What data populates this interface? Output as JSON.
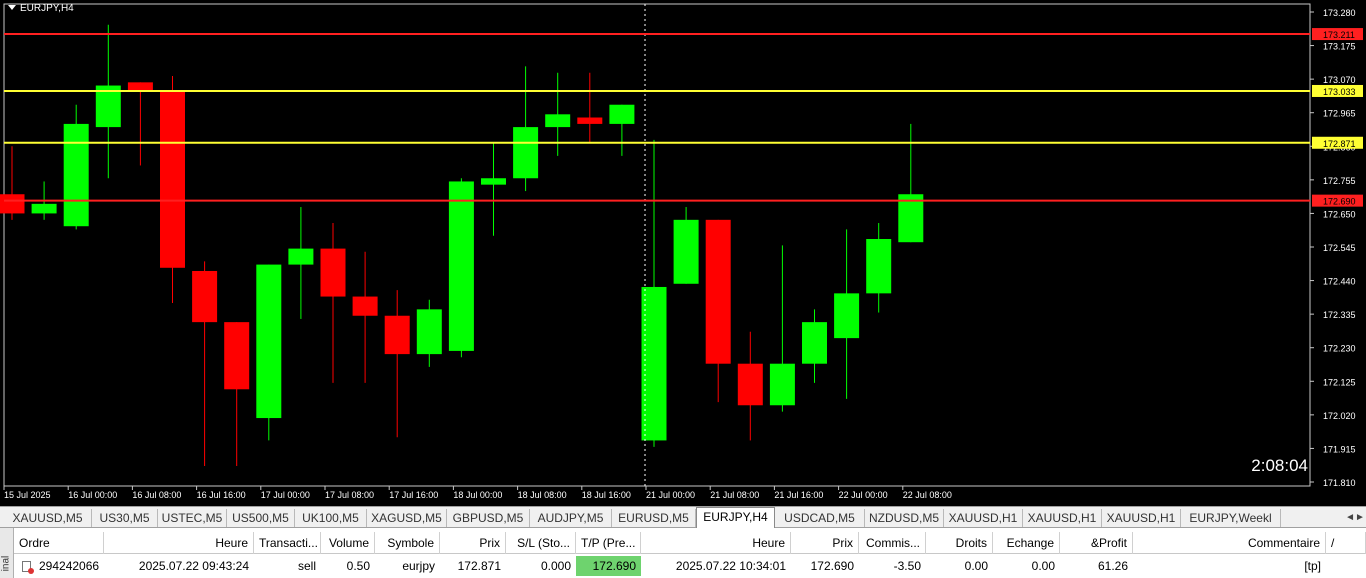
{
  "chart": {
    "title": "EURJPY,H4",
    "countdown": "2:08:04",
    "y_ticks": [
      "173.280",
      "173.175",
      "173.070",
      "172.965",
      "172.860",
      "172.755",
      "172.650",
      "172.545",
      "172.440",
      "172.335",
      "172.230",
      "172.125",
      "172.020",
      "171.915",
      "171.810"
    ],
    "x_ticks": [
      "15 Jul 2025",
      "16 Jul 00:00",
      "16 Jul 08:00",
      "16 Jul 16:00",
      "17 Jul 00:00",
      "17 Jul 08:00",
      "17 Jul 16:00",
      "18 Jul 00:00",
      "18 Jul 08:00",
      "18 Jul 16:00",
      "21 Jul 00:00",
      "21 Jul 08:00",
      "21 Jul 16:00",
      "22 Jul 00:00",
      "22 Jul 08:00"
    ],
    "lines": [
      {
        "price": 173.211,
        "label": "173.211",
        "color": "#ff2020"
      },
      {
        "price": 173.033,
        "label": "173.033",
        "color": "#ffff33"
      },
      {
        "price": 172.871,
        "label": "172.871",
        "color": "#ffff33"
      },
      {
        "price": 172.69,
        "label": "172.690",
        "color": "#ff2020"
      }
    ],
    "colors": {
      "bull": "#00ff00",
      "bear": "#ff0000",
      "background": "#000000",
      "wick_bull": "#00dd00",
      "wick_bear": "#dd0000"
    }
  },
  "chart_data": {
    "type": "candlestick",
    "symbol": "EURJPY",
    "timeframe": "H4",
    "ylim": [
      171.79,
      173.3
    ],
    "candles": [
      {
        "o": 172.71,
        "h": 172.86,
        "l": 172.63,
        "c": 172.65
      },
      {
        "o": 172.65,
        "h": 172.75,
        "l": 172.63,
        "c": 172.68
      },
      {
        "o": 172.61,
        "h": 172.99,
        "l": 172.6,
        "c": 172.93
      },
      {
        "o": 172.92,
        "h": 173.24,
        "l": 172.76,
        "c": 173.05
      },
      {
        "o": 173.06,
        "h": 173.06,
        "l": 172.8,
        "c": 173.03
      },
      {
        "o": 173.03,
        "h": 173.08,
        "l": 172.37,
        "c": 172.48
      },
      {
        "o": 172.47,
        "h": 172.5,
        "l": 171.86,
        "c": 172.31
      },
      {
        "o": 172.31,
        "h": 172.31,
        "l": 171.86,
        "c": 172.1
      },
      {
        "o": 172.01,
        "h": 172.49,
        "l": 171.94,
        "c": 172.49
      },
      {
        "o": 172.49,
        "h": 172.67,
        "l": 172.32,
        "c": 172.54
      },
      {
        "o": 172.54,
        "h": 172.62,
        "l": 172.12,
        "c": 172.39
      },
      {
        "o": 172.39,
        "h": 172.53,
        "l": 172.12,
        "c": 172.33
      },
      {
        "o": 172.33,
        "h": 172.41,
        "l": 171.95,
        "c": 172.21
      },
      {
        "o": 172.21,
        "h": 172.38,
        "l": 172.17,
        "c": 172.35
      },
      {
        "o": 172.22,
        "h": 172.76,
        "l": 172.2,
        "c": 172.75
      },
      {
        "o": 172.74,
        "h": 172.87,
        "l": 172.58,
        "c": 172.76
      },
      {
        "o": 172.76,
        "h": 173.11,
        "l": 172.72,
        "c": 172.92
      },
      {
        "o": 172.92,
        "h": 173.09,
        "l": 172.83,
        "c": 172.96
      },
      {
        "o": 172.95,
        "h": 173.09,
        "l": 172.87,
        "c": 172.93
      },
      {
        "o": 172.93,
        "h": 172.99,
        "l": 172.83,
        "c": 172.99
      },
      {
        "o": 171.94,
        "h": 172.88,
        "l": 171.92,
        "c": 172.42
      },
      {
        "o": 172.43,
        "h": 172.67,
        "l": 172.43,
        "c": 172.63
      },
      {
        "o": 172.63,
        "h": 172.63,
        "l": 172.06,
        "c": 172.18
      },
      {
        "o": 172.18,
        "h": 172.28,
        "l": 171.94,
        "c": 172.05
      },
      {
        "o": 172.05,
        "h": 172.55,
        "l": 172.03,
        "c": 172.18
      },
      {
        "o": 172.18,
        "h": 172.35,
        "l": 172.12,
        "c": 172.31
      },
      {
        "o": 172.26,
        "h": 172.6,
        "l": 172.07,
        "c": 172.4
      },
      {
        "o": 172.4,
        "h": 172.62,
        "l": 172.34,
        "c": 172.57
      },
      {
        "o": 172.56,
        "h": 172.93,
        "l": 172.56,
        "c": 172.71
      }
    ]
  },
  "tabs": [
    "XAUUSD,M5",
    "US30,M5",
    "USTEC,M5",
    "US500,M5",
    "UK100,M5",
    "XAGUSD,M5",
    "GBPUSD,M5",
    "AUDJPY,M5",
    "EURUSD,M5",
    "EURJPY,H4",
    "USDCAD,M5",
    "NZDUSD,M5",
    "XAUUSD,H1",
    "XAUUSD,H1",
    "XAUUSD,H1",
    "EURJPY,Weekl"
  ],
  "active_tab": "EURJPY,H4",
  "tabs_nav": "◄►",
  "terminal": {
    "side_label": "inal",
    "headers": [
      "Ordre",
      "Heure",
      "Transacti...",
      "Volume",
      "Symbole",
      "Prix",
      "S/L (Sto...",
      "T/P (Pre...",
      "Heure",
      "Prix",
      "Commis...",
      "Droits",
      "Echange",
      "&Profit",
      "Commentaire",
      "/"
    ],
    "row": [
      "294242066",
      "2025.07.22 09:43:24",
      "sell",
      "0.50",
      "eurjpy",
      "172.871",
      "0.000",
      "172.690",
      "2025.07.22 10:34:01",
      "172.690",
      "-3.50",
      "0.00",
      "0.00",
      "61.26",
      "[tp]"
    ]
  }
}
